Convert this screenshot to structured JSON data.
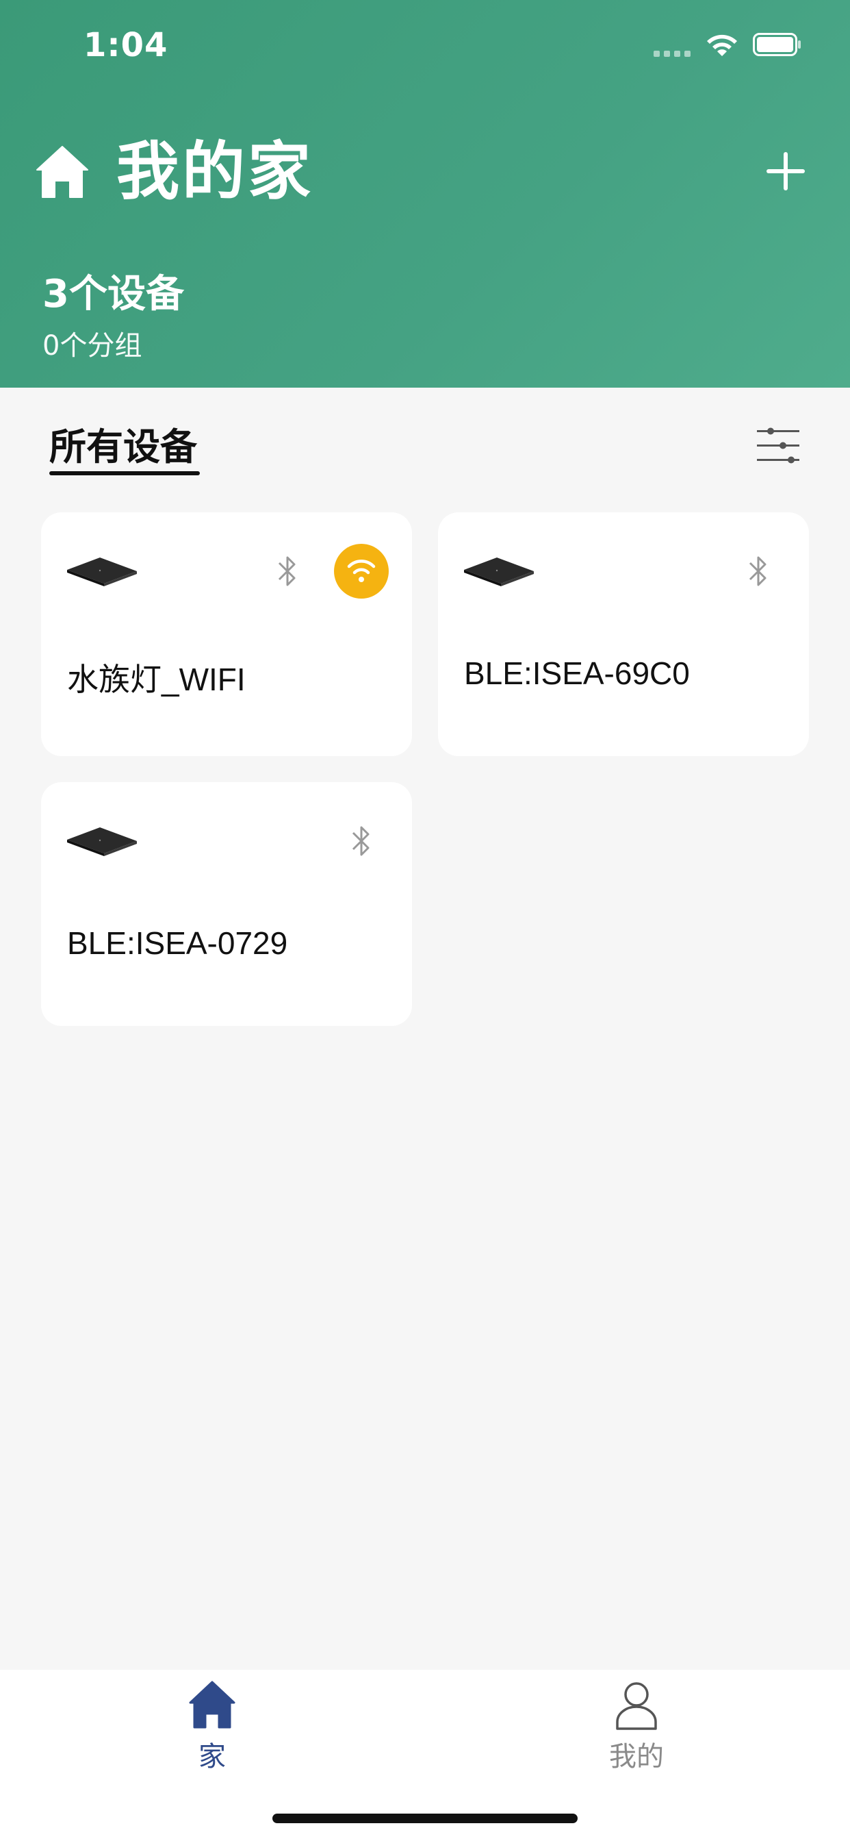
{
  "status_bar": {
    "time": "1:04"
  },
  "header": {
    "title": "我的家",
    "device_count": "3个设备",
    "group_count": "0个分组"
  },
  "tabs": {
    "all_devices": "所有设备"
  },
  "devices": [
    {
      "name": "水族灯_WIFI",
      "bluetooth": true,
      "wifi": true
    },
    {
      "name": "BLE:ISEA-69C0",
      "bluetooth": true,
      "wifi": false
    },
    {
      "name": "BLE:ISEA-0729",
      "bluetooth": true,
      "wifi": false
    }
  ],
  "tabbar": {
    "home_label": "家",
    "mine_label": "我的"
  },
  "colors": {
    "header_green": "#45a283",
    "wifi_badge": "#f5b311",
    "tab_active": "#2f4a8a",
    "tab_inactive": "#8a8a8a"
  }
}
